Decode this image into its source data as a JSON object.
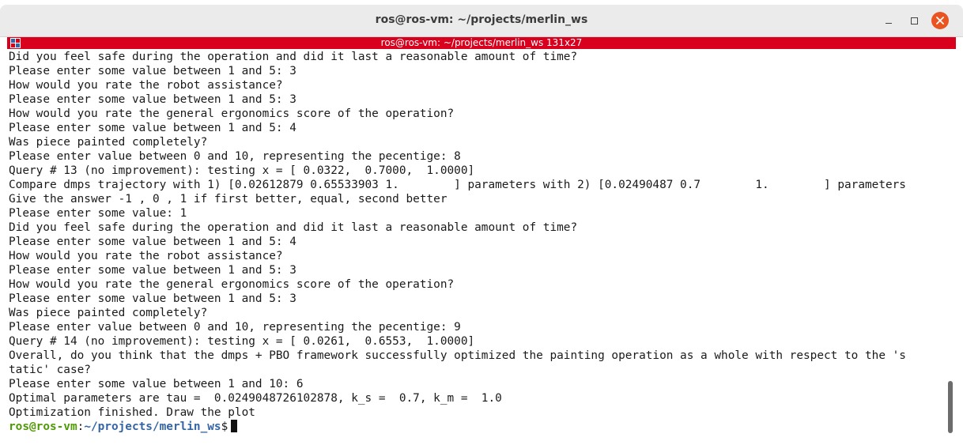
{
  "window": {
    "title": "ros@ros-vm: ~/projects/merlin_ws"
  },
  "tab": {
    "title": "ros@ros-vm: ~/projects/merlin_ws 131x27"
  },
  "terminal": {
    "lines": [
      "Did you feel safe during the operation and did it last a reasonable amount of time?",
      "Please enter some value between 1 and 5: 3",
      "How would you rate the robot assistance?",
      "Please enter some value between 1 and 5: 3",
      "How would you rate the general ergonomics score of the operation?",
      "Please enter some value between 1 and 5: 4",
      "Was piece painted completely?",
      "Please enter value between 0 and 10, representing the pecentige: 8",
      "Query # 13 (no improvement): testing x = [ 0.0322,  0.7000,  1.0000]",
      "Compare dmps trajectory with 1) [0.02612879 0.65533903 1.        ] parameters with 2) [0.02490487 0.7        1.        ] parameters",
      "Give the answer -1 , 0 , 1 if first better, equal, second better",
      "Please enter some value: 1",
      "Did you feel safe during the operation and did it last a reasonable amount of time?",
      "Please enter some value between 1 and 5: 4",
      "How would you rate the robot assistance?",
      "Please enter some value between 1 and 5: 3",
      "How would you rate the general ergonomics score of the operation?",
      "Please enter some value between 1 and 5: 3",
      "Was piece painted completely?",
      "Please enter value between 0 and 10, representing the pecentige: 9",
      "Query # 14 (no improvement): testing x = [ 0.0261,  0.6553,  1.0000]",
      "Overall, do you think that the dmps + PBO framework successfully optimized the painting operation as a whole with respect to the 's",
      "tatic' case?",
      "Please enter some value between 1 and 10: 6",
      "Optimal parameters are tau =  0.0249048726102878, k_s =  0.7, k_m =  1.0",
      "Optimization finished. Draw the plot"
    ],
    "prompt": {
      "user_host": "ros@ros-vm",
      "separator": ":",
      "path": "~/projects/merlin_ws",
      "symbol": "$"
    }
  },
  "colors": {
    "tab_bar": "#d8001c",
    "close_button": "#e95420",
    "prompt_user": "#4e9a06",
    "prompt_path": "#3465a4"
  },
  "icons": {
    "close": "close-icon",
    "minimize": "minimize-icon",
    "maximize": "maximize-icon",
    "terminal": "terminal-icon"
  }
}
